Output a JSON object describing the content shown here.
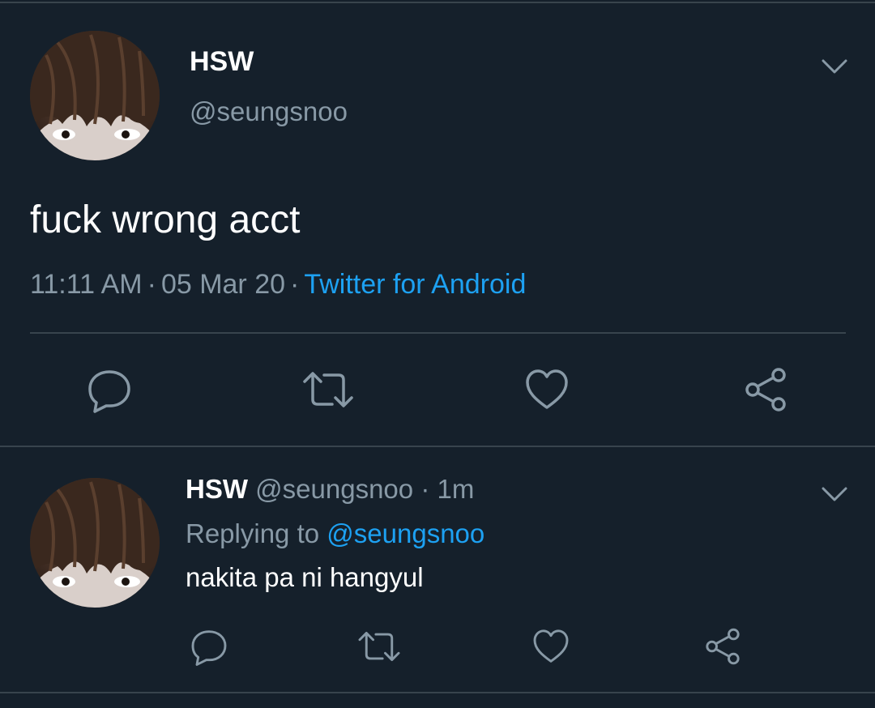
{
  "colors": {
    "background": "#15202b",
    "divider": "#38444d",
    "secondary_text": "#8899a6",
    "link": "#1da1f2",
    "icon": "#8899a6"
  },
  "main_tweet": {
    "name": "HSW",
    "handle": "@seungsnoo",
    "text": "fuck wrong acct",
    "time": "11:11 AM",
    "separator": "·",
    "date": "05 Mar 20",
    "source": "Twitter for Android",
    "icons": [
      "chevron-down-icon",
      "reply-icon",
      "retweet-icon",
      "like-icon",
      "share-icon"
    ]
  },
  "reply_tweet": {
    "name": "HSW",
    "handle": "@seungsnoo",
    "separator": "·",
    "time_ago": "1m",
    "replying_to_label": "Replying to",
    "replying_to_handle": "@seungsnoo",
    "text": "nakita pa ni hangyul",
    "icons": [
      "chevron-down-icon",
      "reply-icon",
      "retweet-icon",
      "like-icon",
      "share-icon"
    ]
  }
}
